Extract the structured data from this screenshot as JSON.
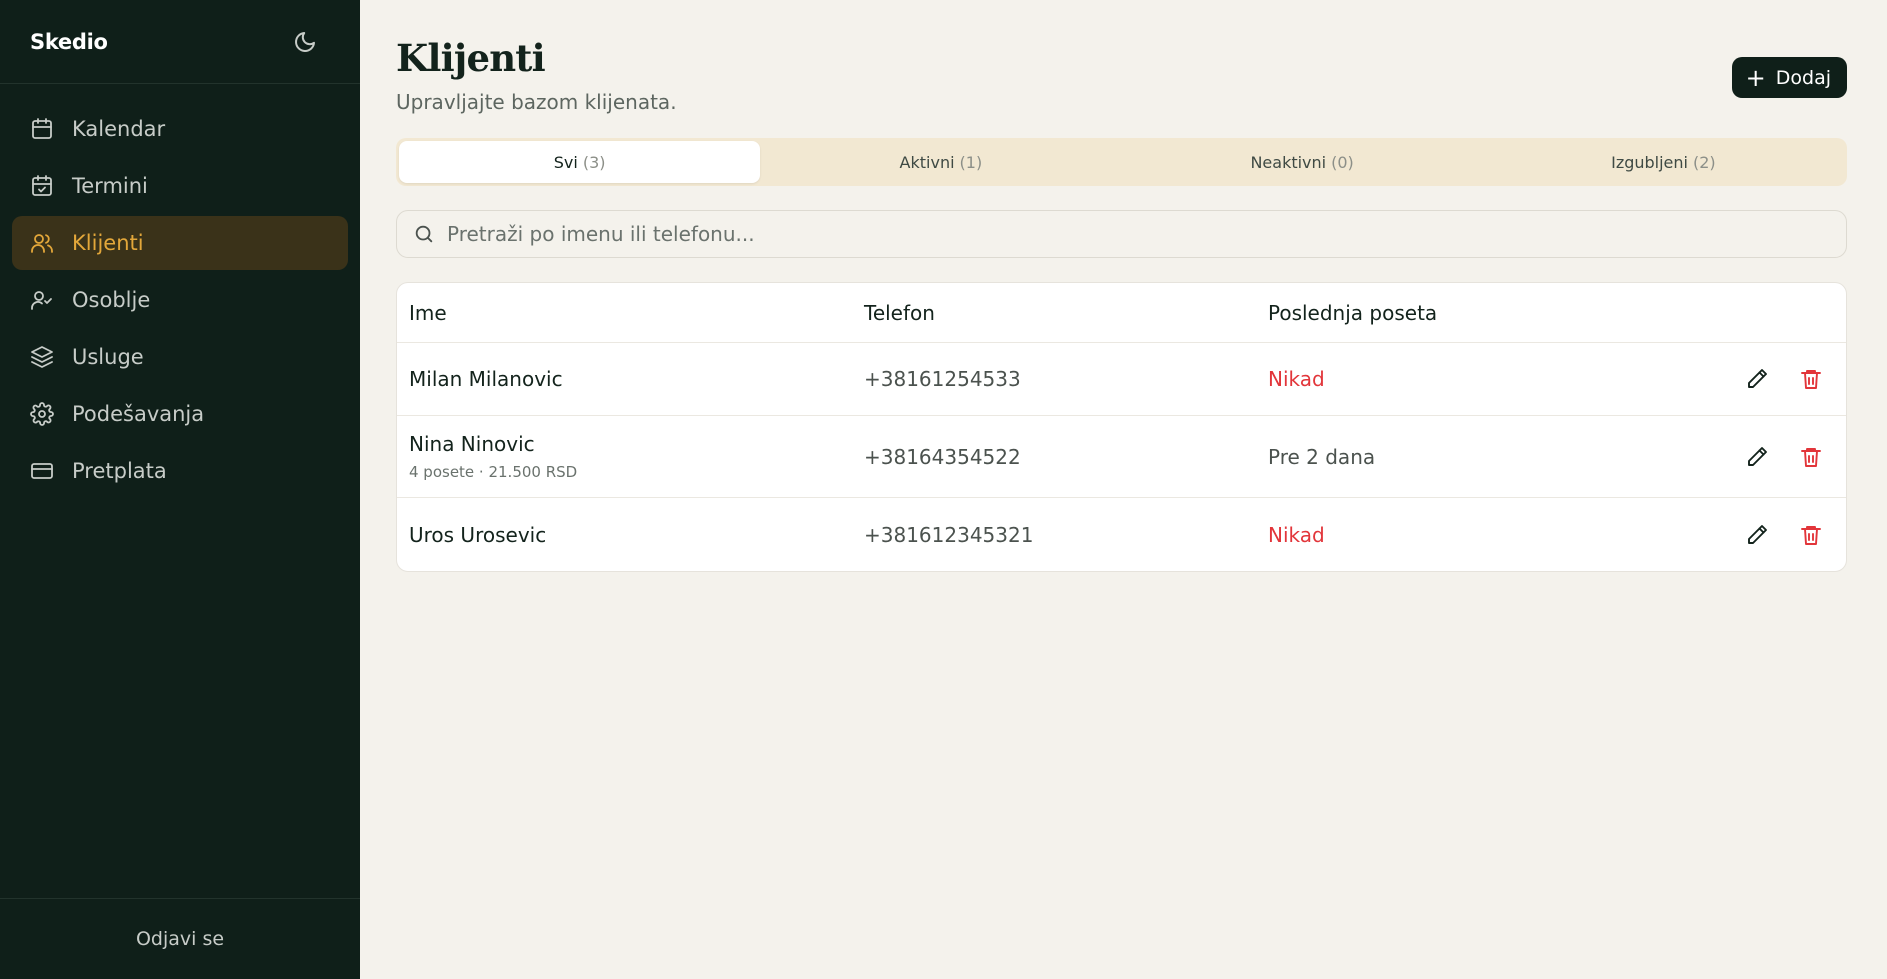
{
  "app": {
    "name": "Skedio"
  },
  "sidebar": {
    "items": [
      {
        "label": "Kalendar",
        "icon": "calendar-icon",
        "active": false
      },
      {
        "label": "Termini",
        "icon": "calendar-check-icon",
        "active": false
      },
      {
        "label": "Klijenti",
        "icon": "users-icon",
        "active": true
      },
      {
        "label": "Osoblje",
        "icon": "user-check-icon",
        "active": false
      },
      {
        "label": "Usluge",
        "icon": "layers-icon",
        "active": false
      },
      {
        "label": "Podešavanja",
        "icon": "gear-icon",
        "active": false
      },
      {
        "label": "Pretplata",
        "icon": "credit-card-icon",
        "active": false
      }
    ],
    "logout_label": "Odjavi se"
  },
  "page": {
    "title": "Klijenti",
    "subtitle": "Upravljajte bazom klijenata.",
    "add_label": "Dodaj"
  },
  "tabs": [
    {
      "label": "Svi",
      "count": "(3)",
      "active": true
    },
    {
      "label": "Aktivni",
      "count": "(1)",
      "active": false
    },
    {
      "label": "Neaktivni",
      "count": "(0)",
      "active": false
    },
    {
      "label": "Izgubljeni",
      "count": "(2)",
      "active": false
    }
  ],
  "search": {
    "placeholder": "Pretraži po imenu ili telefonu..."
  },
  "table": {
    "columns": [
      "Ime",
      "Telefon",
      "Poslednja poseta"
    ],
    "rows": [
      {
        "name": "Milan Milanovic",
        "meta": "",
        "phone": "+38161254533",
        "last_visit": "Nikad"
      },
      {
        "name": "Nina Ninovic",
        "meta": "4 posete · 21.500 RSD",
        "phone": "+38164354522",
        "last_visit": "Pre 2 dana"
      },
      {
        "name": "Uros Urosevic",
        "meta": "",
        "phone": "+381612345321",
        "last_visit": "Nikad"
      }
    ]
  },
  "colors": {
    "sidebar_bg": "#0f1f19",
    "accent": "#e3a73a",
    "danger": "#e2353a",
    "page_bg": "#f4f2ec",
    "tabs_bg": "#f2e8d2"
  }
}
